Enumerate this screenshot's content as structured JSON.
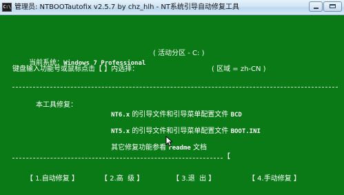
{
  "window": {
    "icon_label": "C:\\",
    "title": "管理员: NTBOOTautofix v2.5.7 by chz_hlh - NT系统引导自动修复工具"
  },
  "console": {
    "system_label": "当前系统：",
    "system_value": "Windows 7 Professional",
    "partition": "( 活动分区 - C: )",
    "prompt": "键盘输入功能号或鼠标点击【 】内选择：",
    "locale": "( 区域 = zh-CN )",
    "repair_label": "本工具修复：",
    "items": [
      {
        "ver": "NT6.x",
        "desc": "的引导文件和引导菜单配置文件",
        "file": "BCD"
      },
      {
        "ver": "NT5.x",
        "desc": "的引导文件和引导菜单配置文件",
        "file": "BOOT.INI"
      }
    ],
    "other_prefix": "其它修复功能参看",
    "other_link": "readme",
    "other_suffix": "文档",
    "bracket_mark": "【",
    "menu": [
      {
        "label": "【 1.自动修复 】"
      },
      {
        "label": "【 2.高  级 】"
      },
      {
        "label": "【 3.退  出 】"
      },
      {
        "label": "【 4.手动修复 】"
      }
    ]
  },
  "colors": {
    "background": "#0a7a16",
    "text": "#ffffff"
  }
}
